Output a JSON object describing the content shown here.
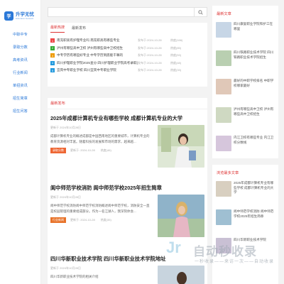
{
  "brand": {
    "title": "升学无忧",
    "subtitle": "Education Network",
    "mark": "学"
  },
  "nav": [
    "中职中专",
    "录取分数",
    "高考资讯",
    "行业新闻",
    "单招资讯",
    "招生简章",
    "招生问答"
  ],
  "search": {
    "placeholder": ""
  },
  "top_tabs": [
    "最新热搜",
    "最新发布"
  ],
  "hot_list": [
    {
      "n": "1",
      "title": "南充职高有护理专业吗 南充职高有哪些专业",
      "date": "发布于:2024-10-28",
      "hot": "热度(166)",
      "color": "#e44"
    },
    {
      "n": "2",
      "title": "泸州有哪些高中卫校 泸州有哪些高中卫校招生",
      "date": "发布于:2024-10-28",
      "hot": "热度(85)",
      "color": "#3a3"
    },
    {
      "n": "3",
      "title": "中专学历有哪些好专业 中专学历到底能干嘛的",
      "date": "发布于:2024-10-28",
      "hot": "热度(53)",
      "color": "#e90"
    },
    {
      "n": "4",
      "title": "四川护理职业学院2025查分 四川护理职业学院高考录取查询",
      "date": "发布于:2024-10-28",
      "hot": "热度(48)",
      "color": "#29d"
    },
    {
      "n": "5",
      "title": "宜宾中专职业学校 四川宜宾中专职业学院",
      "date": "发布于:2024-10-28",
      "hot": "热度(33)",
      "color": "#29d"
    }
  ],
  "latest_title": "最新发布",
  "articles": [
    {
      "title": "2025年成都计算机专业有哪些学校 成都计算机专业的大学",
      "meta": "更新于 2024年10月28日",
      "excerpt": "成都计算机专业的概述成都是中国西南地区的重要城市，计算机专业的教育资源相对丰富。随着科技的发展和市场的需求，越来越...",
      "tag": "录取分数",
      "date": "更新于: 2024-10-28",
      "hot": "热度(46)"
    },
    {
      "title": "阆中师范学校消防 阆中师范学校2025年招生简章",
      "meta": "更新于 2024年10月28日",
      "excerpt": "阆中师范学校消防阆中师范学校消防概述阆中师范学校，消防安全一直是校园管理的重要组成部分。作为一名江湖人，我深刻体会...",
      "tag": "行业新闻",
      "date": "更新于: 2024-10-28",
      "hot": "热度(35)"
    },
    {
      "title": "四川华新职业技术学院 四川华新职业技术学院地址",
      "meta": "更新于 2024年10月28日",
      "excerpt": "四川华新职业技术学院的相关介绍",
      "tag": "",
      "date": "",
      "hot": ""
    }
  ],
  "right_recent": {
    "title": "最新文章",
    "items": [
      "四川康复职业学院和护工在哪里",
      "四川铁路职业技术学院 四川铁路职业技术学院招生",
      "最好的中职学校排名 中职学校哪家最好",
      "泸州有哪些高中卫校 泸州有哪些高中卫校招生",
      "内江卫校有哪些专业 内江卫校分数线"
    ]
  },
  "right_browse": {
    "title": "浏览最多文章",
    "items": [
      "2025年成都计算机专业有哪些学校 成都计算机专业的大学",
      "阆中师范学校消防 阆中师范学校2025年招生简章",
      "四川华新职业技术学院"
    ]
  },
  "watermark": {
    "big": "自动秒收录",
    "small": "一秒收录——来访一次——自动收录",
    "logo": "Jr"
  }
}
